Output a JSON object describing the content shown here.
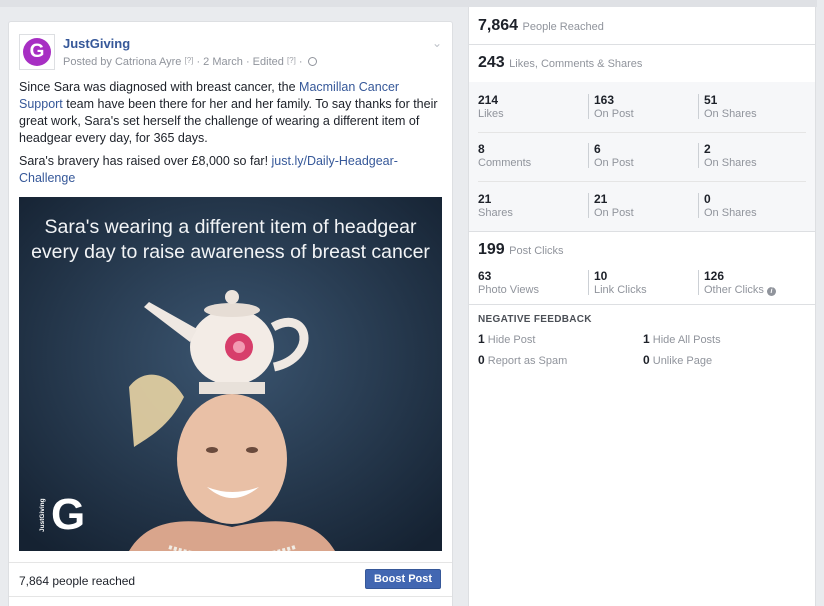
{
  "post": {
    "page_name": "JustGiving",
    "logo_letter": "G",
    "posted_by": "Posted by Catriona Ayre",
    "q1": "[?]",
    "date": "· 2 March · Edited",
    "q2": "[?]",
    "dot": "·",
    "text1_a": "Since Sara was diagnosed with breast cancer, the ",
    "text1_link": "Macmillan Cancer Support",
    "text1_b": " team have been there for her and her family. To say thanks for their great work, Sara's set herself the challenge of wearing a different item of headgear every day, for 365 days.",
    "text2_a": "Sara's bravery has raised over £8,000 so far! ",
    "text2_link": "just.ly/Daily-Headgear-Challenge",
    "image_caption_line1": "Sara's wearing a different item of headgear",
    "image_caption_line2": "every day to raise awareness of breast cancer",
    "image_logo_side": "JustGiving",
    "image_logo_g": "G",
    "reach": "7,864 people reached",
    "boost": "Boost Post"
  },
  "stats": {
    "people_reached_num": "7,864",
    "people_reached_label": "People Reached",
    "engagement_num": "243",
    "engagement_label": "Likes, Comments & Shares",
    "rows": [
      [
        {
          "num": "214",
          "label": "Likes"
        },
        {
          "num": "163",
          "label": "On Post"
        },
        {
          "num": "51",
          "label": "On Shares"
        }
      ],
      [
        {
          "num": "8",
          "label": "Comments"
        },
        {
          "num": "6",
          "label": "On Post"
        },
        {
          "num": "2",
          "label": "On Shares"
        }
      ],
      [
        {
          "num": "21",
          "label": "Shares"
        },
        {
          "num": "21",
          "label": "On Post"
        },
        {
          "num": "0",
          "label": "On Shares"
        }
      ]
    ],
    "post_clicks_num": "199",
    "post_clicks_label": "Post Clicks",
    "clicks": [
      {
        "num": "63",
        "label": "Photo Views"
      },
      {
        "num": "10",
        "label": "Link Clicks"
      },
      {
        "num": "126",
        "label": "Other Clicks"
      }
    ],
    "info_icon": "i",
    "negative_title": "NEGATIVE FEEDBACK",
    "negative": [
      {
        "num": "1",
        "label": "Hide Post"
      },
      {
        "num": "1",
        "label": "Hide All Posts"
      },
      {
        "num": "0",
        "label": "Report as Spam"
      },
      {
        "num": "0",
        "label": "Unlike Page"
      }
    ]
  },
  "colors": {
    "link": "#365899",
    "boost": "#4267b2",
    "brand": "#a72fc3"
  }
}
